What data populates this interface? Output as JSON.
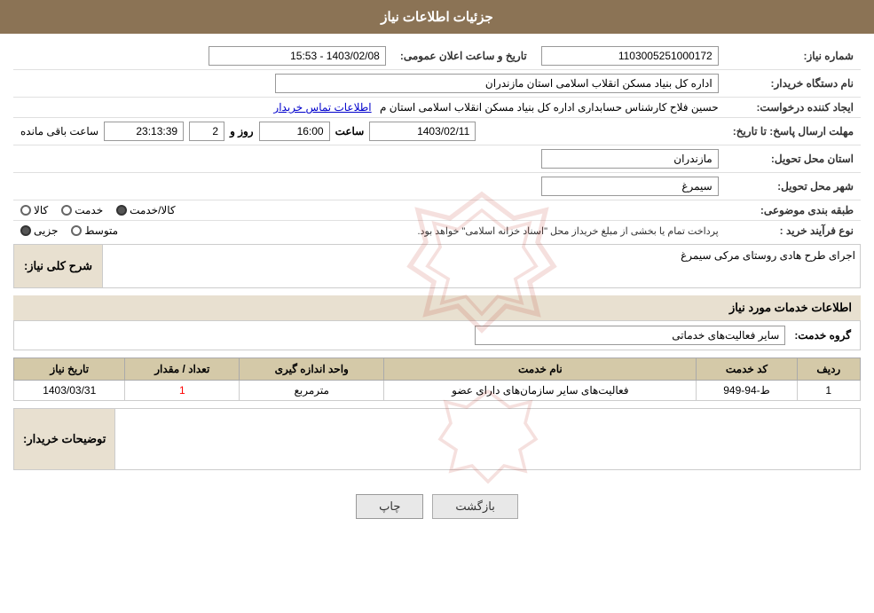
{
  "header": {
    "title": "جزئیات اطلاعات نیاز"
  },
  "fields": {
    "need_number_label": "شماره نیاز:",
    "need_number_value": "1103005251000172",
    "announce_date_label": "تاریخ و ساعت اعلان عمومی:",
    "announce_date_value": "1403/02/08 - 15:53",
    "buyer_org_label": "نام دستگاه خریدار:",
    "buyer_org_value": "اداره کل بنیاد مسکن انقلاب اسلامی استان مازندران",
    "creator_label": "ایجاد کننده درخواست:",
    "creator_value": "حسین فلاح کارشناس حسابداری اداره کل بنیاد مسکن انقلاب اسلامی استان م",
    "creator_link": "اطلاعات تماس خریدار",
    "reply_deadline_label": "مهلت ارسال پاسخ: تا تاریخ:",
    "reply_date": "1403/02/11",
    "reply_time_label": "ساعت",
    "reply_time": "16:00",
    "reply_days_label": "روز و",
    "reply_days": "2",
    "reply_remaining_label": "ساعت باقی مانده",
    "reply_remaining": "23:13:39",
    "province_label": "استان محل تحویل:",
    "province_value": "مازندران",
    "city_label": "شهر محل تحویل:",
    "city_value": "سیمرغ",
    "category_label": "طبقه بندی موضوعی:",
    "radio_kala": "کالا",
    "radio_khedmat": "خدمت",
    "radio_kala_khedmat": "کالا/خدمت",
    "radio_kala_khedmat_selected": true,
    "purchase_type_label": "نوع فرآیند خرید :",
    "radio_jozei": "جزیی",
    "radio_mottavaset": "متوسط",
    "purchase_note": "پرداخت تمام یا بخشی از مبلغ خریداز محل \"اسناد خزانه اسلامی\" خواهد بود.",
    "description_section_label": "شرح کلی نیاز:",
    "description_value": "اجرای طرح هادی روستای مرکی سیمرغ",
    "services_section_label": "اطلاعات خدمات مورد نیاز",
    "service_group_label": "گروه خدمت:",
    "service_group_value": "سایر فعالیت‌های خدماتی",
    "table_headers": [
      "ردیف",
      "کد خدمت",
      "نام خدمت",
      "واحد اندازه گیری",
      "تعداد / مقدار",
      "تاریخ نیاز"
    ],
    "table_rows": [
      {
        "row": "1",
        "code": "ط-94-949",
        "name": "فعالیت‌های سایر سازمان‌های دارای عضو",
        "unit": "مترمربع",
        "count": "1",
        "date": "1403/03/31"
      }
    ],
    "buyer_notes_label": "توضیحات خریدار:",
    "buyer_notes_value": "",
    "btn_print": "چاپ",
    "btn_back": "بازگشت"
  }
}
